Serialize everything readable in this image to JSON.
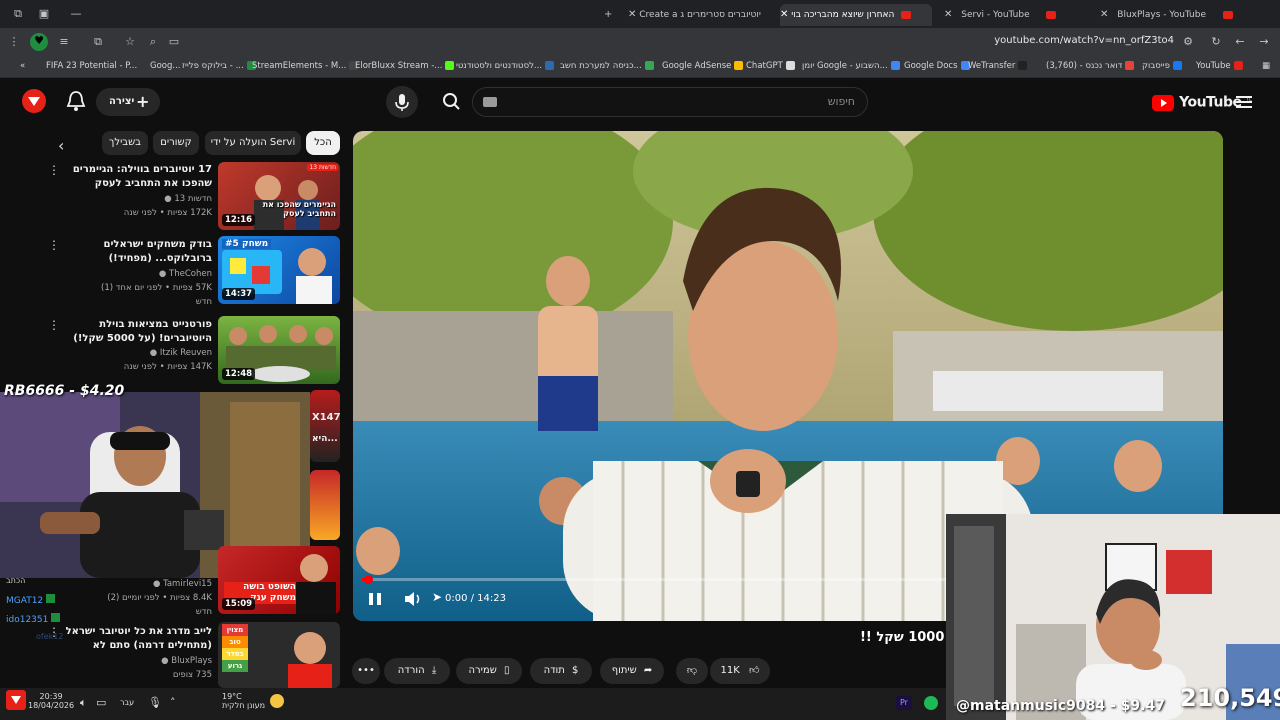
{
  "tabs": [
    {
      "label": "Create a יוטיוברים סטרימרים ג"
    },
    {
      "label": "האחרון שיוצא מהבריכה בוי"
    },
    {
      "label": "Servi - YouTube"
    },
    {
      "label": "BluxPlays - YouTube"
    }
  ],
  "address": {
    "url": "youtube.com/watch?v=nn_orfZ3to4"
  },
  "bookmarks": [
    {
      "label": "FIFA 23 Potential - P...",
      "color": "#3b7ddd"
    },
    {
      "label": "Goog...",
      "color": "#888888"
    },
    {
      "label": "בילוקס פלייז - ...",
      "color": "#1e8e3e"
    },
    {
      "label": "StreamElements - M...",
      "color": "#222222"
    },
    {
      "label": "ElorBluxx Stream -...",
      "color": "#111111"
    },
    {
      "label": "לסטודנטים ולסטודנטי...",
      "color": "#53fc18"
    },
    {
      "label": "כניסה למערכת חשב...",
      "color": "#2b6cb0"
    },
    {
      "label": "Google AdSense",
      "color": "#34a853"
    },
    {
      "label": "ChatGPT",
      "color": "#fbbc04"
    },
    {
      "label": "יומן Google - השבוע...",
      "color": "#dddddd"
    },
    {
      "label": "Google Docs",
      "color": "#4285f4"
    },
    {
      "label": "WeTransfer",
      "color": "#4285f4"
    },
    {
      "label": "(3,760) - דואר נכנס",
      "color": "#222222"
    },
    {
      "label": "פייסבוק",
      "color": "#ea4335"
    },
    {
      "label": "YouTube",
      "color": "#1877f2"
    }
  ],
  "header": {
    "create_label": "יצירה",
    "search_placeholder": "חיפוש",
    "logo_text": "YouTube",
    "logo_sup": "IL"
  },
  "chips": [
    {
      "label": "הכל"
    },
    {
      "label": "הועלה על ידי Servi"
    },
    {
      "label": "קשורים"
    },
    {
      "label": "בשבילך"
    }
  ],
  "related": [
    {
      "title": "17 יוטיוברים בווילה: הגיימרים שהפכו את התחביב לעסק",
      "channel": "חדשות 13",
      "meta": "172K צפיות • לפני שנה",
      "duration": "12:16",
      "thumb_text": "הגיימרים שהפכו את התחביב לעסק",
      "badge": "חדשות 13"
    },
    {
      "title": "בודק משחקים ישראלים ברובלוקס... (מפחיד!)",
      "channel": "TheCohen",
      "meta": "57K צפיות • לפני יום אחד (1)",
      "new": "חדש",
      "duration": "14:37",
      "thumb_text": "משחק #5"
    },
    {
      "title": "פורטנייט במציאות בוילת היוטיוברים! (על 5000 שקל!)",
      "channel": "Itzik Reuven",
      "meta": "147K צפיות • לפני שנה",
      "duration": "12:48"
    },
    {
      "title": "",
      "channel": "Tamirlevi15",
      "meta": "8.4K צפיות • לפני יומיים (2)",
      "new": "חדש",
      "duration": "15:09",
      "thumb_text": "השופט בושה משחק ענק"
    },
    {
      "title": "לייב מדרג את כל יוטיובר ישראל (מתחילים דרמה) סתם לא",
      "channel": "BluxPlays",
      "meta": "735 צופים",
      "thumb_text": "מצוין טוב בסדר גרוע"
    }
  ],
  "player": {
    "time": "0:00 / 14:23",
    "title": "1000 שקל !!",
    "progress": 0.01
  },
  "actions": {
    "likes": "11K",
    "share": "שיתוף",
    "thanks": "תודה",
    "save": "שמירה",
    "download": "הורדה"
  },
  "overlays": {
    "donation_top": "RB6666 - $4.20",
    "donation_bottom": "@matanmusic9084 - $9.47",
    "viewers": "210,549",
    "cam_badge": "X147",
    "cam_caption": "היא..."
  },
  "chat": [
    {
      "user": "MGAT12",
      "color": "#4aa3ff"
    },
    {
      "user": "ido12351",
      "color": "#4aa3ff"
    },
    {
      "user": "ofek12",
      "color": "#3b6dbf"
    }
  ],
  "chat_hint": "הכתב",
  "taskbar": {
    "time": "20:39",
    "date": "18/04/2026",
    "lang": "עבר",
    "weather_temp": "19°C",
    "weather_desc": "מעונן חלקית"
  }
}
